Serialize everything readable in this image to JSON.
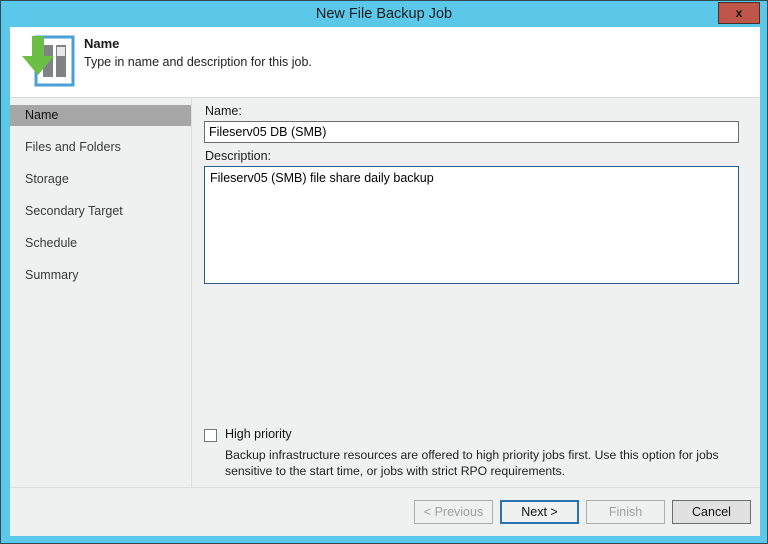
{
  "window": {
    "title": "New File Backup Job",
    "close_label": "x",
    "accent_color": "#5bc8ea",
    "close_color": "#c0564a"
  },
  "header": {
    "title": "Name",
    "subtitle": "Type in name and description for this job.",
    "icon": "file-backup-job-icon"
  },
  "sidebar": {
    "items": [
      {
        "label": "Name",
        "selected": true
      },
      {
        "label": "Files and Folders",
        "selected": false
      },
      {
        "label": "Storage",
        "selected": false
      },
      {
        "label": "Secondary Target",
        "selected": false
      },
      {
        "label": "Schedule",
        "selected": false
      },
      {
        "label": "Summary",
        "selected": false
      }
    ],
    "selected_background": "#a6a6a6"
  },
  "form": {
    "name_label": "Name:",
    "name_value": "Fileserv05 DB (SMB)",
    "name_placeholder": "",
    "description_label": "Description:",
    "description_value": "Fileserv05 (SMB) file share daily backup",
    "description_placeholder": "",
    "priority_label": "High priority",
    "priority_checked": false,
    "priority_description": "Backup infrastructure resources are offered to high priority jobs first. Use this option for jobs sensitive to the start time, or jobs with strict RPO requirements."
  },
  "footer": {
    "previous_label": "< Previous",
    "next_label": "Next >",
    "finish_label": "Finish",
    "cancel_label": "Cancel",
    "default_button_border": "#2b72ad"
  }
}
